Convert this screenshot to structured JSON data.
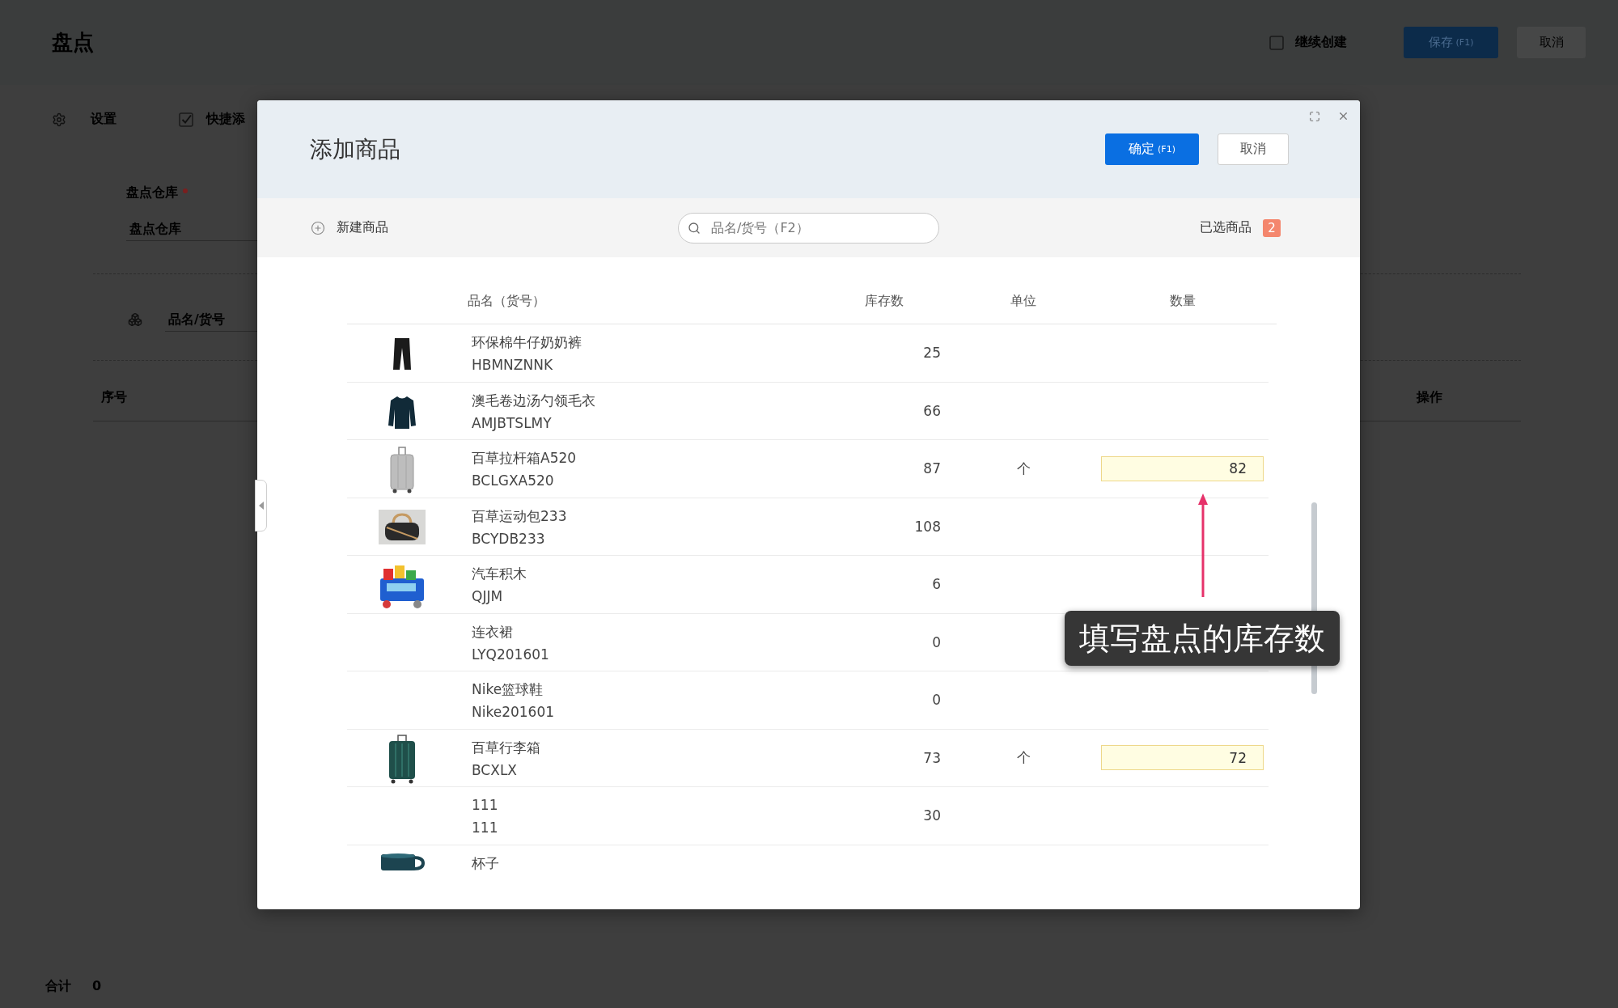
{
  "page": {
    "title": "盘点",
    "continue_create": {
      "label": "继续创建",
      "checked": false
    },
    "save_button": {
      "label": "保存",
      "shortcut": "(F1)"
    },
    "cancel_button": {
      "label": "取消"
    },
    "toolbar": [
      {
        "kind": "settings",
        "label": "设置"
      },
      {
        "kind": "checkbox",
        "label": "快捷添",
        "checked": true
      }
    ],
    "warehouse": {
      "label": "盘点仓库",
      "required": true,
      "placeholder": "盘点仓库"
    },
    "product_search": {
      "placeholder": "品名/货号"
    },
    "columns": [
      "序号",
      "操作"
    ],
    "total": {
      "label": "合计",
      "value": "0"
    }
  },
  "dialog": {
    "title": "添加商品",
    "confirm_button": {
      "label": "确定",
      "shortcut": "(F1)"
    },
    "cancel_button": {
      "label": "取消"
    },
    "new_product": {
      "label": "新建商品"
    },
    "search": {
      "placeholder": "品名/货号（F2）"
    },
    "selected": {
      "label": "已选商品",
      "count": "2"
    },
    "table": {
      "columns": [
        "品名（货号）",
        "库存数",
        "单位",
        "数量"
      ],
      "rows": [
        {
          "photo": true,
          "name": "环保棉牛仔奶奶裤",
          "code": "HBMNZNNK",
          "stock": "25"
        },
        {
          "photo": true,
          "name": "澳毛卷边汤勺领毛衣",
          "code": "AMJBTSLMY",
          "stock": "66"
        },
        {
          "photo": true,
          "name": "百草拉杆箱A520",
          "code": "BCLGXA520",
          "stock": "87",
          "unit": "个",
          "quantity": "82"
        },
        {
          "photo": true,
          "name": "百草运动包233",
          "code": "BCYDB233",
          "stock": "108"
        },
        {
          "photo": true,
          "name": "汽车积木",
          "code": "QJJM",
          "stock": "6"
        },
        {
          "photo": false,
          "name": "连衣裙",
          "code": "LYQ201601",
          "stock": "0"
        },
        {
          "photo": false,
          "name": "Nike篮球鞋",
          "code": "Nike201601",
          "stock": "0"
        },
        {
          "photo": true,
          "name": "百草行李箱",
          "code": "BCXLX",
          "stock": "73",
          "unit": "个",
          "quantity": "72"
        },
        {
          "photo": false,
          "name": "111",
          "code": "111",
          "stock": "30"
        },
        {
          "photo": true,
          "name": "杯子"
        }
      ]
    }
  },
  "callout": {
    "text": "填写盘点的库存数"
  }
}
